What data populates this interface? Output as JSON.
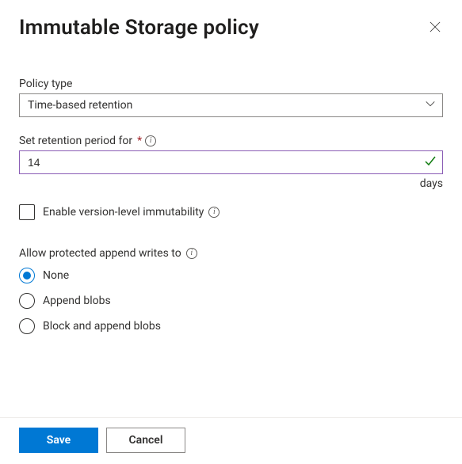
{
  "header": {
    "title": "Immutable Storage policy"
  },
  "policy_type": {
    "label": "Policy type",
    "value": "Time-based retention"
  },
  "retention": {
    "label": "Set retention period for",
    "required_marker": "*",
    "value": "14",
    "unit": "days"
  },
  "version_immutability": {
    "label": "Enable version-level immutability",
    "checked": false
  },
  "append_writes": {
    "label": "Allow protected append writes to",
    "options": {
      "none": "None",
      "append": "Append blobs",
      "block_append": "Block and append blobs"
    },
    "selected": "none"
  },
  "footer": {
    "save": "Save",
    "cancel": "Cancel"
  },
  "info_glyph": "i"
}
